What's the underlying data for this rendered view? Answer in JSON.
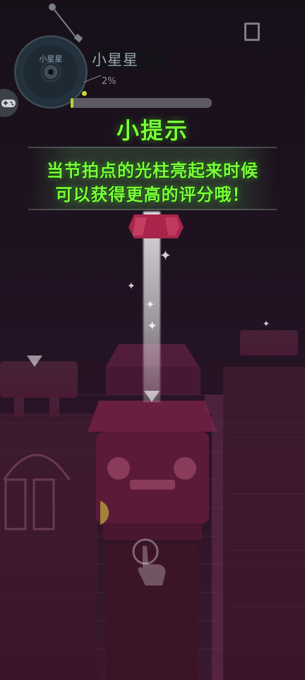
{
  "player": {
    "disc_label": "小星星",
    "song_title": "小星星",
    "progress_percent": 2,
    "progress_text": "2%",
    "accent_color": "#bcd13a"
  },
  "controls": {
    "pause_icon": "pause-icon",
    "gamepad_icon": "gamepad-icon"
  },
  "tip": {
    "title": "小提示",
    "line1": "当节拍点的光柱亮起来时候",
    "line2": "可以获得更高的评分哦！",
    "color": "#7dff3a"
  }
}
